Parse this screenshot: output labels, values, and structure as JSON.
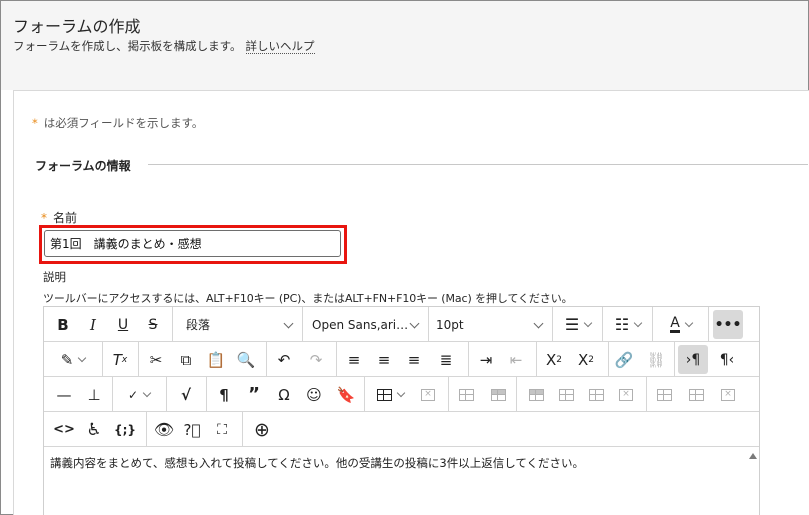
{
  "header": {
    "title": "フォーラムの作成",
    "subtitle": "フォーラムを作成し、掲示板を構成します。",
    "help_link": "詳しいヘルプ"
  },
  "form": {
    "required_note": "は必須フィールドを示します。",
    "section_title": "フォーラムの情報",
    "name_label": "名前",
    "name_value": "第1回　講義のまとめ・感想",
    "description_label": "説明",
    "description_hint": "ツールバーにアクセスするには、ALT+F10キー (PC)、またはALT+FN+F10キー (Mac) を押してください。"
  },
  "toolbar": {
    "paragraph_format": "段落",
    "font_family": "Open Sans,ari…",
    "font_size": "10pt"
  },
  "editor": {
    "content": "講義内容をまとめて、感想も入れて投稿してください。他の受講生の投稿に3件以上返信してください。"
  },
  "colors": {
    "required_star": "#e88a17",
    "highlight_box": "#e8150f",
    "header_bg": "#f5f5f5"
  }
}
